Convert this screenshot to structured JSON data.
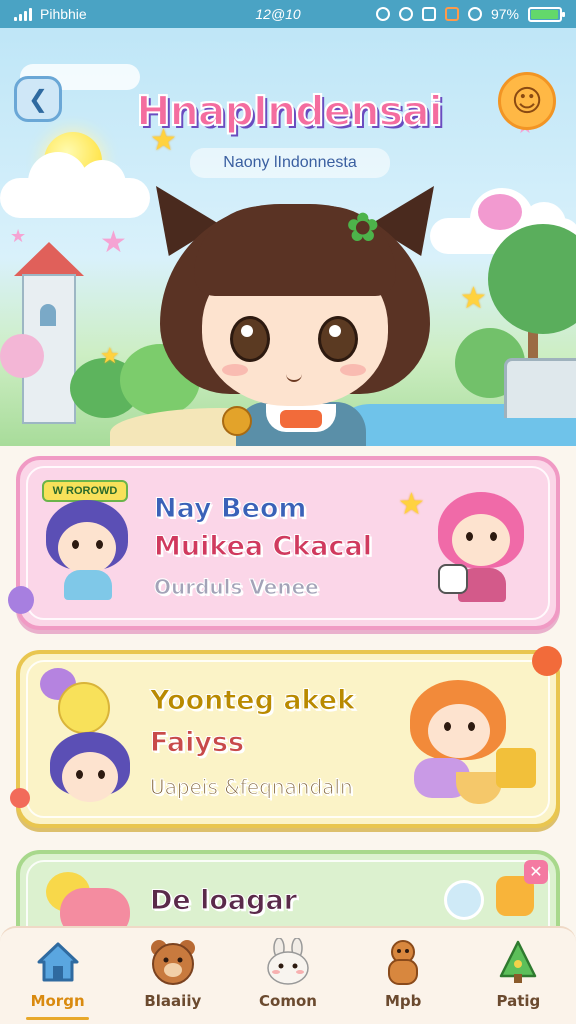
{
  "status_bar": {
    "carrier": "Pihbhie",
    "time": "12@10",
    "battery": "97%",
    "battery_level": 0.97
  },
  "header": {
    "title": "HnapIndensai",
    "subtitle": "Naony lIndonnesta",
    "back_icon": "back-arrow-icon",
    "mascot_icon": "smiley-face-icon"
  },
  "cards": [
    {
      "tag": "W ROROWD",
      "title": "Nay Beom",
      "subtitle": "Muikea Ckacal",
      "caption": "Ourduls Venee",
      "accent": "#f09ac4"
    },
    {
      "title": "Yoonteg akek",
      "subtitle": "Faiyss",
      "caption": "Uapeis &feqnandaln",
      "accent": "#e9c64f"
    },
    {
      "title": "De loagar",
      "close_icon": "close-icon",
      "accent": "#a8d88c"
    }
  ],
  "bottom_nav": [
    {
      "label": "Morgn",
      "icon": "home-icon",
      "active": true
    },
    {
      "label": "Blaaiiy",
      "icon": "bear-icon",
      "active": false
    },
    {
      "label": "Comon",
      "icon": "bunny-icon",
      "active": false
    },
    {
      "label": "Mpb",
      "icon": "gingerbread-icon",
      "active": false
    },
    {
      "label": "Patig",
      "icon": "tree-icon",
      "active": false
    }
  ],
  "colors": {
    "status_bar": "#4aa3c4",
    "nav_active": "#d98a10"
  }
}
